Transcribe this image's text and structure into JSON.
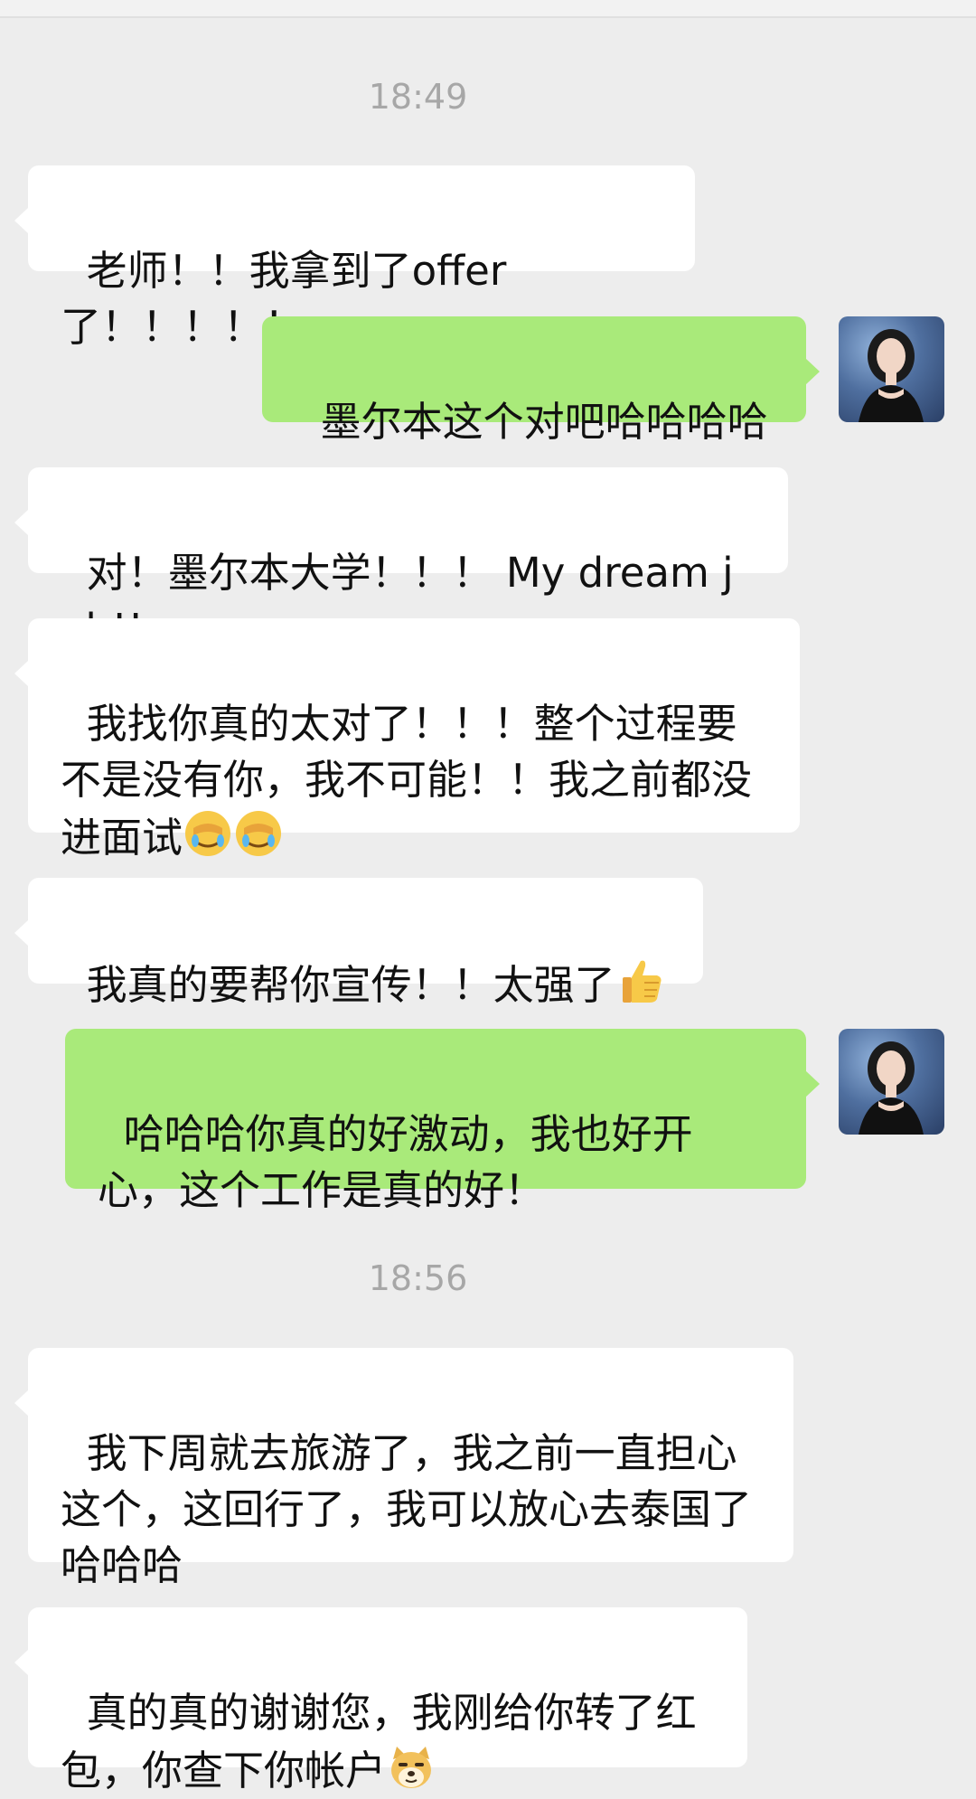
{
  "chat": {
    "timestamps": [
      "18:49",
      "18:56"
    ],
    "messages": [
      {
        "side": "left",
        "text": "老师！！我拿到了offer了！！！！！"
      },
      {
        "side": "right",
        "text": "墨尔本这个对吧哈哈哈哈"
      },
      {
        "side": "left",
        "text": "对！墨尔本大学！！！ My dream job!!"
      },
      {
        "side": "left",
        "text": "我找你真的太对了！！！整个过程要不是没有你，我不可能！！我之前都没进面试",
        "emojis": [
          "facepalm-crying-emoji",
          "facepalm-crying-emoji"
        ]
      },
      {
        "side": "left",
        "text": "我真的要帮你宣传！！太强了",
        "emojis": [
          "thumbs-up-emoji"
        ]
      },
      {
        "side": "right",
        "text": "哈哈哈你真的好激动，我也好开心，这个工作是真的好！"
      },
      {
        "side": "left",
        "text": "我下周就去旅游了，我之前一直担心这个，这回行了，我可以放心去泰国了哈哈哈"
      },
      {
        "side": "left",
        "text": "真的真的谢谢您，我刚给你转了红包，你查下你帐户",
        "emojis": [
          "doge-emoji"
        ]
      }
    ]
  },
  "colors": {
    "background": "#ededed",
    "left_bubble": "#ffffff",
    "right_bubble": "#a9ea7a",
    "timestamp_text": "#a7a7a7"
  }
}
